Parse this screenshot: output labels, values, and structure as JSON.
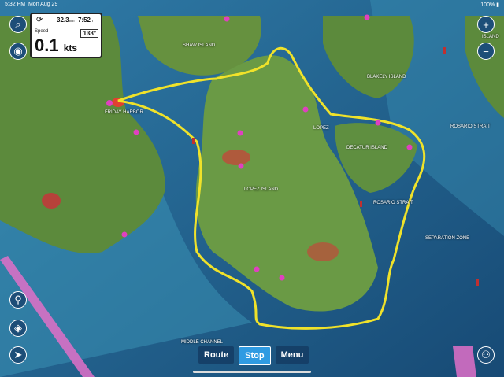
{
  "status_bar": {
    "time": "5:32 PM",
    "date": "Mon Aug 29",
    "battery": "100%"
  },
  "instrument_panel": {
    "distance": "32.3",
    "distance_unit": "nm",
    "eta": "7:52",
    "eta_unit": "h",
    "speed_label": "Speed",
    "speed_value": "0.1",
    "speed_unit": "kts",
    "course": "138°"
  },
  "route_bar": {
    "route_label": "Route",
    "stop_label": "Stop",
    "menu_label": "Menu"
  },
  "map_labels": [
    "SHAW ISLAND",
    "LOPEZ",
    "DECATUR ISLAND",
    "ROSARIO STRAIT",
    "ROSARIO STRAIT",
    "LOPEZ ISLAND",
    "BLAKELY ISLAND",
    "MIDDLE CHANNEL",
    "FRIDAY HARBOR",
    "ISLAND",
    "SEPARATION ZONE"
  ],
  "colors": {
    "water": "#1d5f8a",
    "land": "#5c8a3c",
    "route": "#f0e22a",
    "button_active": "#2f9be2"
  }
}
